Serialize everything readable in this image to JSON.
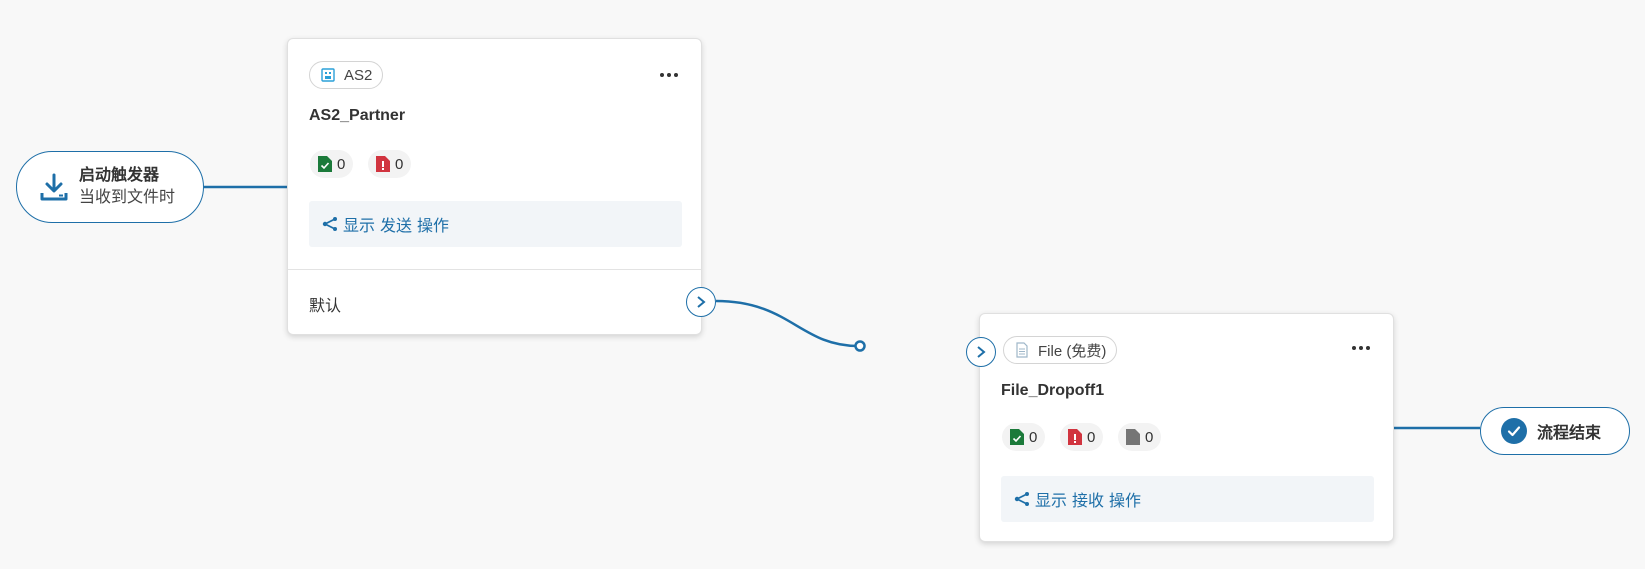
{
  "trigger": {
    "title": "启动触发器",
    "subtitle": "当收到文件时",
    "icon": "download-icon"
  },
  "cards": [
    {
      "tag": "AS2",
      "tag_icon": "as2-building-icon",
      "name": "AS2_Partner",
      "counters": [
        {
          "icon": "file-success-icon",
          "value": "0",
          "color": "#1b7a3a"
        },
        {
          "icon": "file-error-icon",
          "value": "0",
          "color": "#d1343f"
        }
      ],
      "action": {
        "show": "显示",
        "type": "发送",
        "ops": "操作"
      },
      "output": "默认"
    },
    {
      "tag": "File (免费)",
      "tag_icon": "file-icon",
      "name": "File_Dropoff1",
      "counters": [
        {
          "icon": "file-success-icon",
          "value": "0",
          "color": "#1b7a3a"
        },
        {
          "icon": "file-error-icon",
          "value": "0",
          "color": "#d1343f"
        },
        {
          "icon": "file-neutral-icon",
          "value": "0",
          "color": "#757575"
        }
      ],
      "action": {
        "show": "显示",
        "type": "接收",
        "ops": "操作"
      }
    }
  ],
  "end": {
    "label": "流程结束",
    "icon": "check-circle-icon"
  },
  "colors": {
    "accent": "#1e6fa8",
    "background": "#f8f8f8"
  }
}
